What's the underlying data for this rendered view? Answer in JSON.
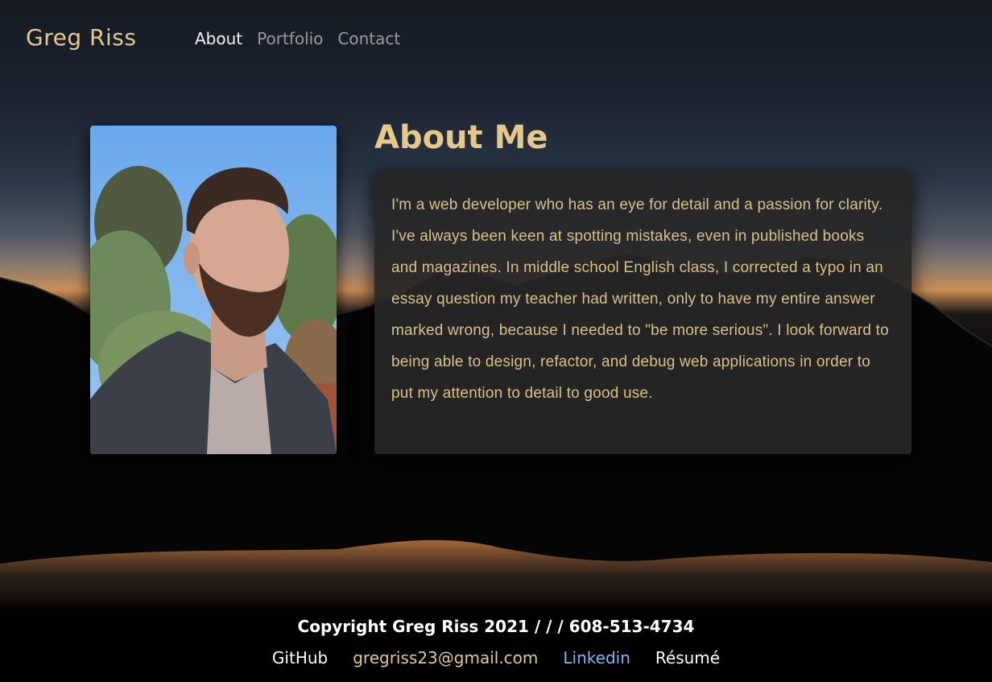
{
  "nav": {
    "brand": "Greg Riss",
    "links": [
      {
        "label": "About"
      },
      {
        "label": "Portfolio"
      },
      {
        "label": "Contact"
      }
    ]
  },
  "about": {
    "title": "About Me",
    "paragraph": "I'm a web developer who has an eye for detail and a passion for clarity. I've always been keen at spotting mistakes, even in published books and magazines. In middle school English class, I corrected a typo in an essay question my teacher had written, only to have my entire answer marked wrong, because I needed to \"be more serious\". I look forward to being able to design, refactor, and debug web applications in order to put my attention to detail to good use."
  },
  "footer": {
    "copyright": "Copyright Greg Riss 2021 / / / 608-513-4734",
    "links": {
      "github": "GitHub",
      "email": "gregriss23@gmail.com",
      "linkedin": "Linkedin",
      "resume": "Résumé"
    }
  },
  "colors": {
    "accent": "#e5c88a",
    "link_blue": "#7db8f0"
  }
}
